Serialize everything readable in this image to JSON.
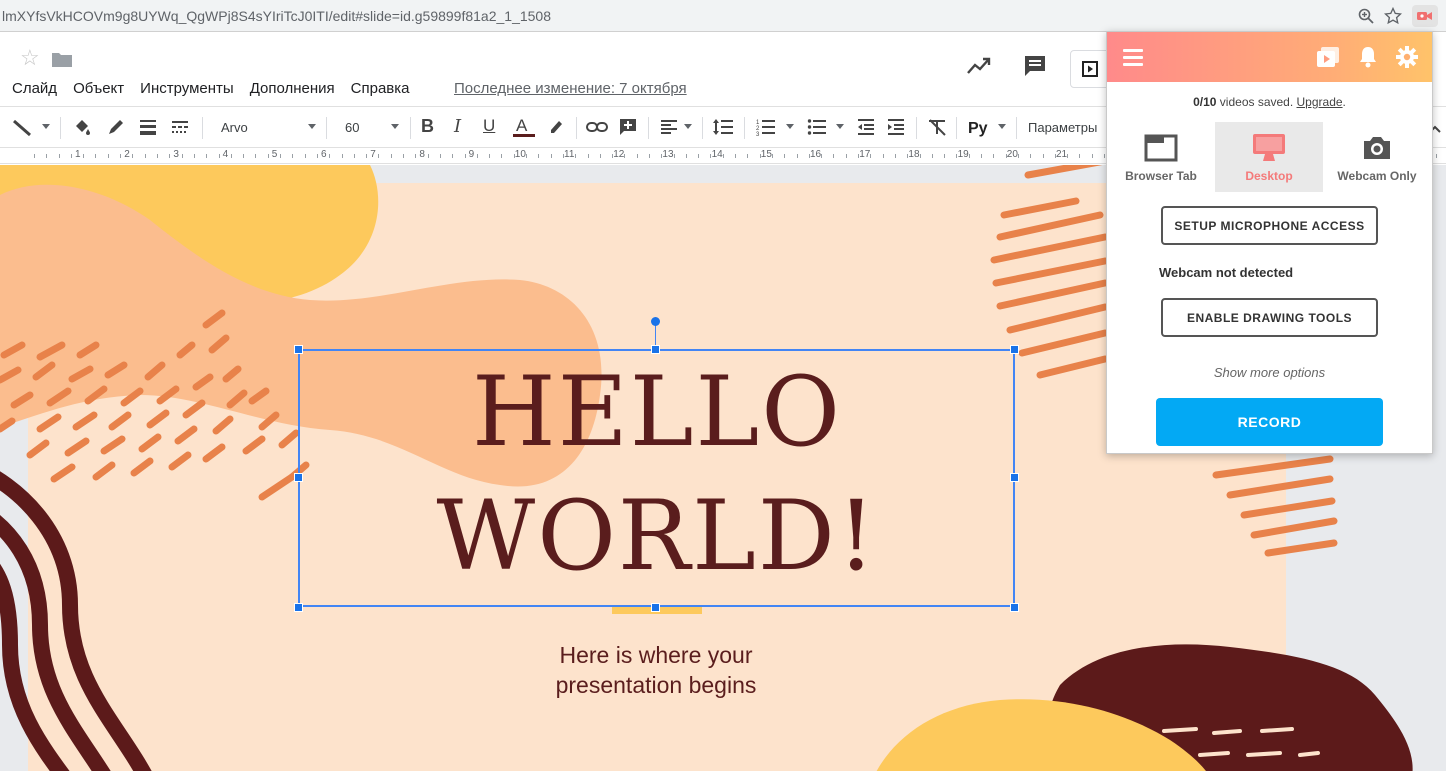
{
  "browser": {
    "url": "lmXYfsVkHCOVm9g8UYWq_QgWPj8S4sYIriTcJ0ITI/edit#slide=id.g59899f81a2_1_1508"
  },
  "menu": {
    "items": [
      "Слайд",
      "Объект",
      "Инструменты",
      "Дополнения",
      "Справка"
    ],
    "last_edit": "Последнее изменение: 7 октября"
  },
  "toolbar": {
    "font_name": "Arvo",
    "font_size": "60",
    "options_label": "Параметры"
  },
  "ruler": {
    "numbers": [
      "1",
      "2",
      "3",
      "4",
      "5",
      "6",
      "7",
      "8",
      "9",
      "10",
      "11",
      "12",
      "13",
      "14",
      "15",
      "16",
      "17",
      "18",
      "19",
      "20",
      "21"
    ]
  },
  "slide": {
    "title_line1": "HELLO",
    "title_line2": "WORLD!",
    "subtitle_line1": "Here is where your",
    "subtitle_line2": "presentation begins"
  },
  "recorder": {
    "saved_count": "0/10",
    "saved_text": " videos saved. ",
    "upgrade_link": "Upgrade",
    "saved_end": ".",
    "modes": [
      {
        "label": "Browser Tab",
        "icon": "browser-tab-icon"
      },
      {
        "label": "Desktop",
        "icon": "desktop-icon",
        "active": true
      },
      {
        "label": "Webcam Only",
        "icon": "camera-icon"
      }
    ],
    "setup_mic_label": "SETUP MICROPHONE ACCESS",
    "webcam_status": "Webcam not detected",
    "drawing_tools_label": "ENABLE DRAWING TOOLS",
    "more_options": "Show more options",
    "record_label": "RECORD",
    "accent_color": "#03a9f4"
  },
  "colors": {
    "slide_bg": "#fde3cc",
    "title_color": "#5a1d1d",
    "blob_orange": "#fbbd8e",
    "blob_yellow": "#fdc95c",
    "stroke_orange": "#e8824a",
    "dark_brown": "#5c1a1a"
  }
}
